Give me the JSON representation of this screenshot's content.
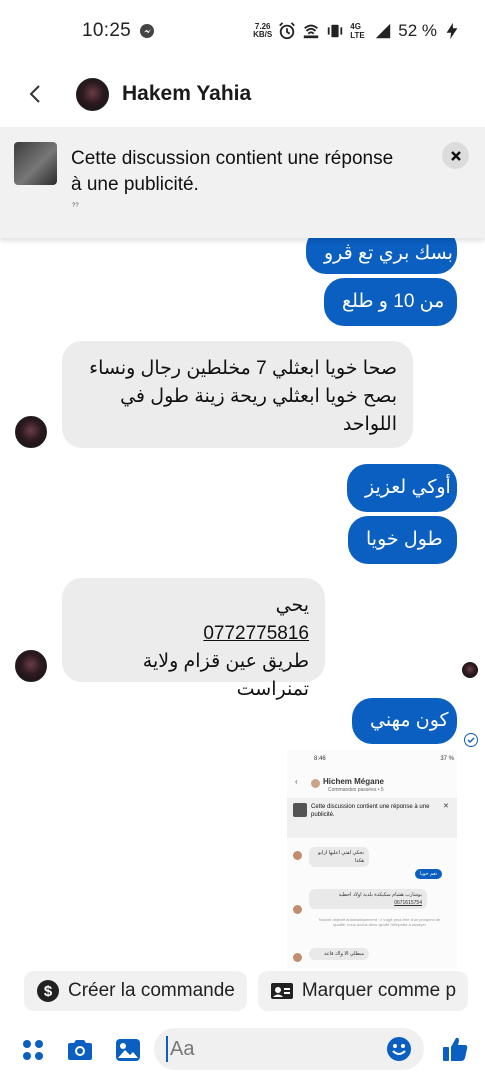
{
  "status_bar": {
    "time": "10:25",
    "net_speed_value": "7.26",
    "net_speed_unit": "KB/S",
    "network": "4G LTE",
    "battery": "52 %"
  },
  "header": {
    "contact_name": "Hakem Yahia"
  },
  "ad_banner": {
    "text": "Cette discussion contient une réponse à une publicité.",
    "tiny": "??"
  },
  "messages": [
    {
      "dir": "out",
      "text": "بسك بري تع ڨرو"
    },
    {
      "dir": "out",
      "text": "من 10 و طلع"
    },
    {
      "dir": "in",
      "text": "صحا خويا ابعثلي 7 مخلطين رجال ونساء بصح خويا ابعثلي ريحة زينة طول في اللواحد"
    },
    {
      "dir": "out",
      "text": "أوكي لعزيز"
    },
    {
      "dir": "out",
      "text": "طول خويا"
    },
    {
      "dir": "in",
      "line1": "يحي",
      "phone": "0772775816",
      "line3": "طريق عين قزام ولاية تمنراست"
    },
    {
      "dir": "out",
      "text": "كون مهني"
    }
  ],
  "shared_screenshot": {
    "status_time": "8:46",
    "status_battery": "37 %",
    "contact": "Hichem Mégane",
    "subtitle": "Commandes passées • 5",
    "ad_text": "Cette discussion contient une réponse à une publicité.",
    "msg1": "نحكي لفتي اعليها ازابو هكدا",
    "msg2": "نعم خويا",
    "msg3": "بوشارب هشام سكيكدة بلدية اولاد احطية",
    "msg3_phone": "0671615754",
    "note": "Nouvel objectif automatiquement : il s'agit peut-être d'un prospect de qualité; nous avons donc ajouté l'étiquette à essayer",
    "msg4": "مبطلي الا واك قاعد"
  },
  "quick_actions": {
    "create_order": "Créer la commande",
    "mark_as": "Marquer comme p"
  },
  "composer": {
    "placeholder": "Aa"
  },
  "colors": {
    "accent": "#0a5fc0",
    "incoming_bubble": "#ececec",
    "banner_bg": "#f1f1f1"
  }
}
